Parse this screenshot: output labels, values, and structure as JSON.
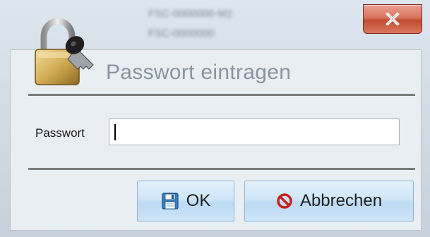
{
  "window": {
    "blurred_title_lines": [
      "FSC-0000000-M2",
      "FSC-0000000"
    ],
    "close_label": "x"
  },
  "dialog": {
    "title": "Passwort eintragen",
    "password_label": "Passwort",
    "password_value": "",
    "ok_label": "OK",
    "cancel_label": "Abbrechen"
  },
  "icons": {
    "header": "lock-with-key-icon",
    "ok": "floppy-disk-icon",
    "cancel": "no-entry-icon",
    "close": "close-icon"
  },
  "colors": {
    "close_button": "#c24b31",
    "button_face": "#cfe6f8",
    "title_text": "#8a949f",
    "cancel_icon": "#c81f1f"
  }
}
